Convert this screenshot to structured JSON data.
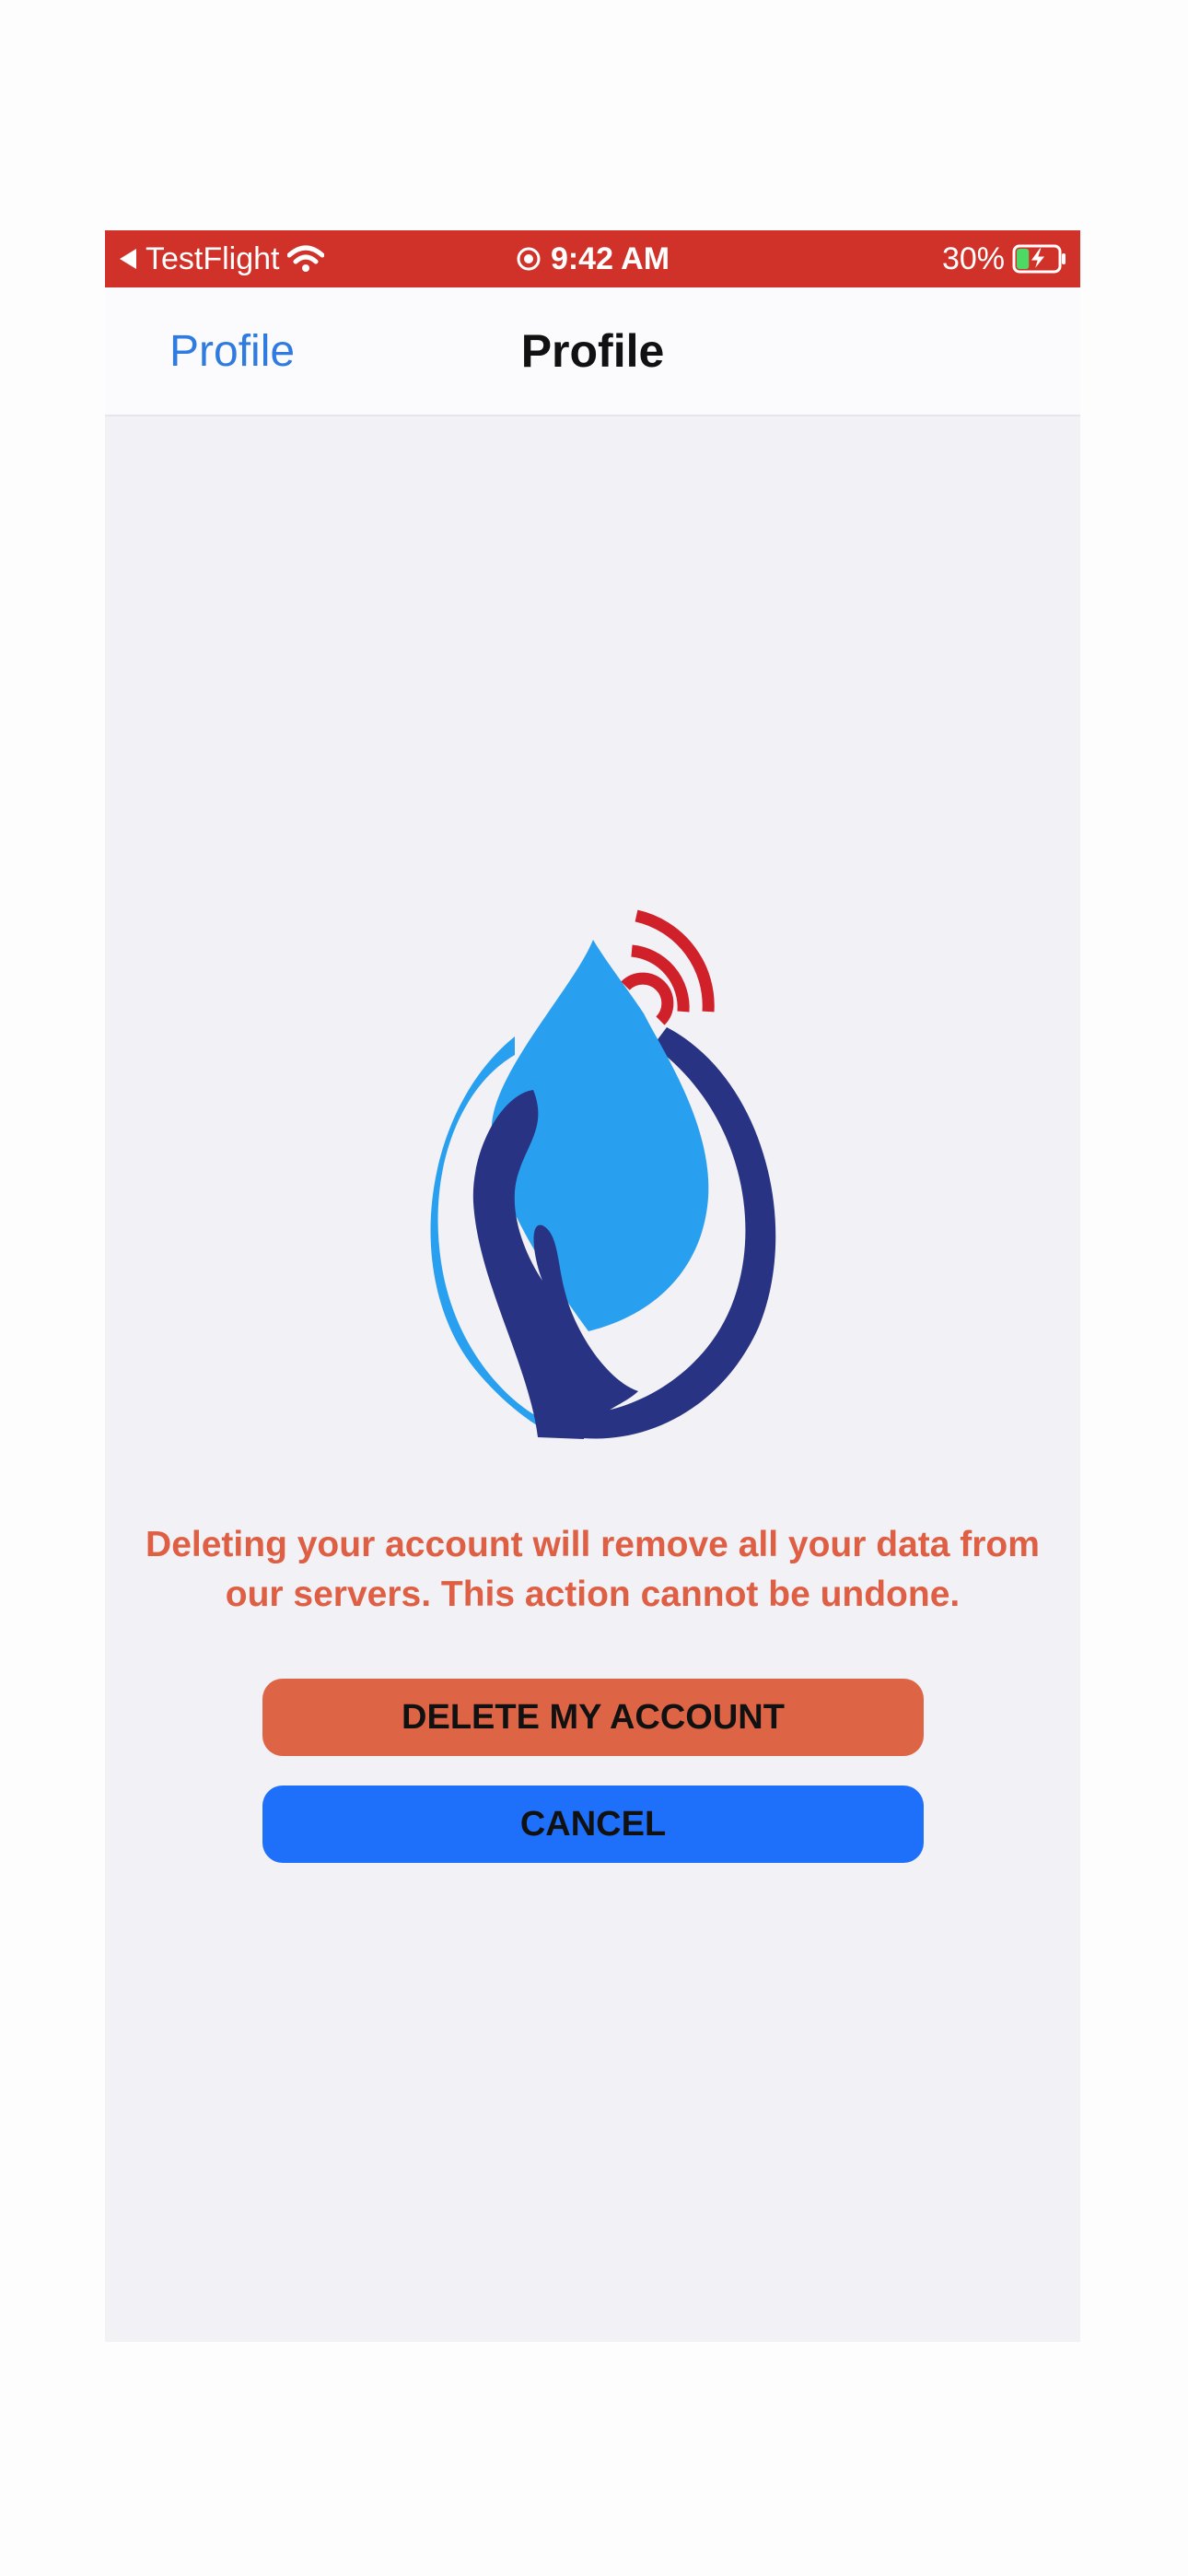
{
  "status_bar": {
    "back_app": "TestFlight",
    "time": "9:42 AM",
    "battery_percent": "30%",
    "battery_level": 0.3
  },
  "nav": {
    "back_label": "Profile",
    "title": "Profile"
  },
  "content": {
    "warning_text": "Deleting your account will remove all your data from our servers. This action cannot be undone.",
    "delete_button_label": "DELETE MY ACCOUNT",
    "cancel_button_label": "CANCEL"
  },
  "icons": {
    "status_back": "back-arrow-icon",
    "wifi": "wifi-icon",
    "lock": "orientation-lock-icon",
    "battery": "battery-charging-icon",
    "logo": "water-drop-hand-logo"
  },
  "colors": {
    "status_bar": "#d0322a",
    "nav_link": "#2f7be0",
    "warning": "#de5f43",
    "delete_button": "#de6446",
    "cancel_button": "#1e6ff9",
    "logo_light_blue": "#29a0ef",
    "logo_dark_blue": "#283383",
    "logo_red": "#d0202a"
  }
}
